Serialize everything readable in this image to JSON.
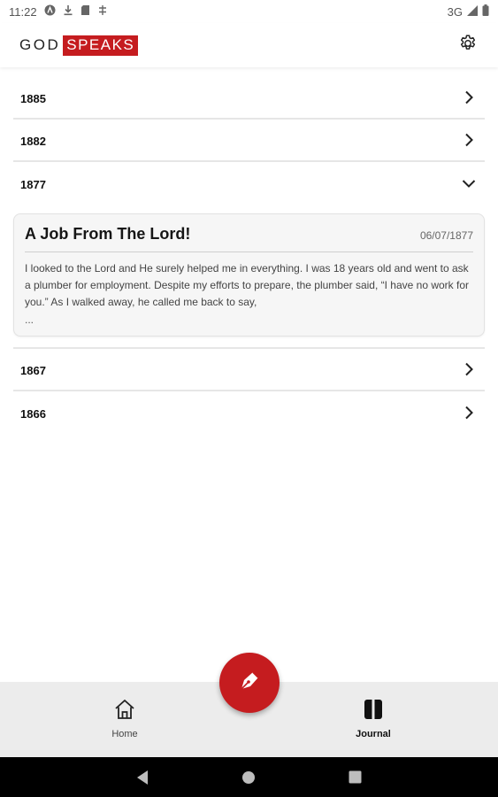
{
  "status_bar": {
    "time": "11:22",
    "network": "3G",
    "icons": [
      "a-icon",
      "download-icon",
      "sd-card-icon",
      "sync-icon",
      "signal-icon",
      "battery-icon"
    ]
  },
  "app_bar": {
    "logo_part1": "GOD",
    "logo_part2": "SPEAKS",
    "settings_icon": "gear-icon"
  },
  "years": [
    {
      "label": "1885",
      "expanded": false
    },
    {
      "label": "1882",
      "expanded": false
    },
    {
      "label": "1877",
      "expanded": true
    },
    {
      "label": "1867",
      "expanded": false
    },
    {
      "label": "1866",
      "expanded": false
    }
  ],
  "entry": {
    "title": "A Job From The Lord!",
    "date": "06/07/1877",
    "body": "I looked to the Lord and He surely helped me in everything. I was 18 years old and went to ask a plumber for employment. Despite my efforts to prepare, the plumber said, “I have no work for you.” As I walked away, he called me back to say,",
    "more": "..."
  },
  "bottom_nav": {
    "home_label": "Home",
    "journal_label": "Journal",
    "selected": "Journal"
  },
  "fab": {
    "icon": "pen-nib-icon"
  },
  "colors": {
    "brand_red": "#c51c1f",
    "nav_background": "#ececec",
    "card_background": "#f6f6f6"
  }
}
